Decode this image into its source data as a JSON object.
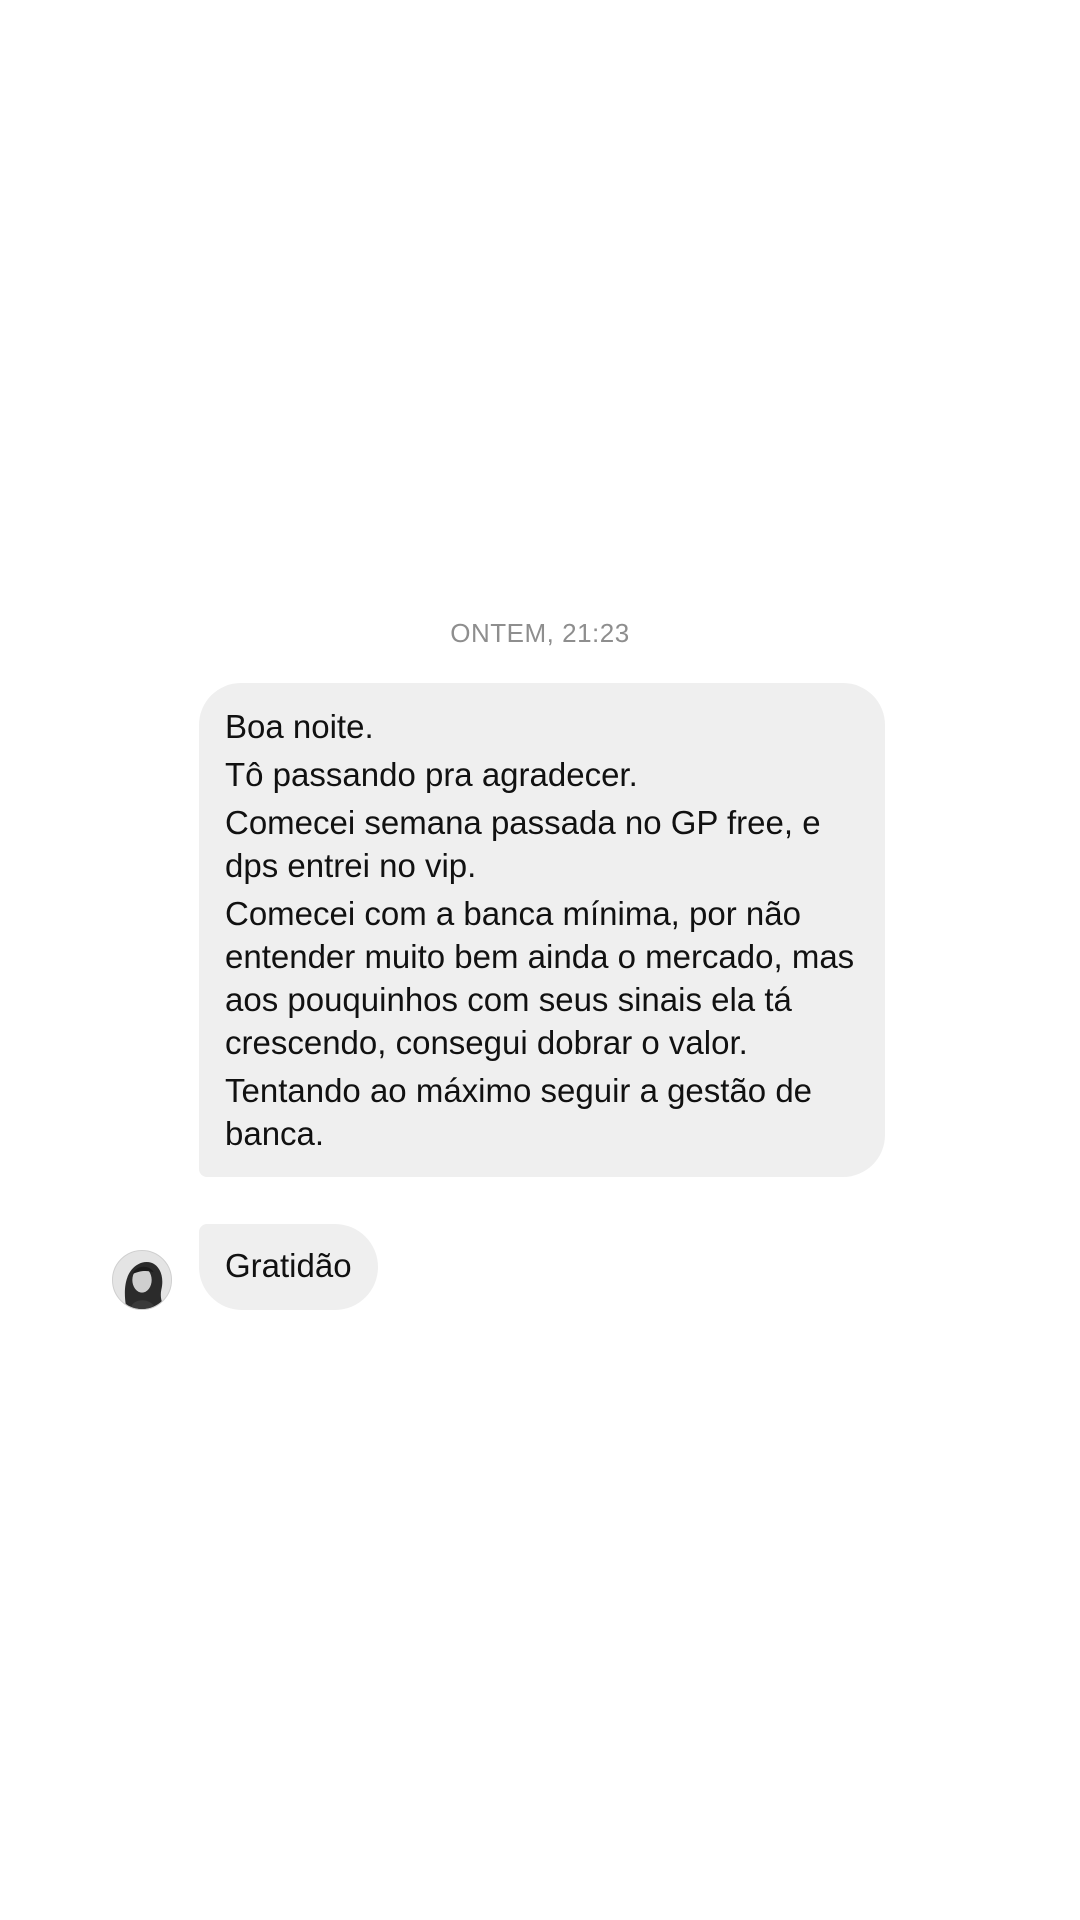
{
  "conversation": {
    "timestamp": "ONTEM, 21:23",
    "messages": [
      {
        "paragraphs": [
          "Boa noite.",
          "Tô passando pra agradecer.",
          "Comecei semana passada no GP free, e dps entrei no vip.",
          "Comecei com a banca mínima, por não entender muito bem ainda o mercado, mas aos pouquinhos com seus sinais ela tá crescendo, consegui dobrar o valor.",
          "Tentando ao máximo seguir a gestão de banca."
        ]
      },
      {
        "text": "Gratidão"
      }
    ],
    "sender": {
      "avatar_icon": "profile-photo-avatar"
    }
  },
  "colors": {
    "background": "#ffffff",
    "bubble": "#efefef",
    "timestamp": "#8e8e8e",
    "text": "#111111"
  }
}
